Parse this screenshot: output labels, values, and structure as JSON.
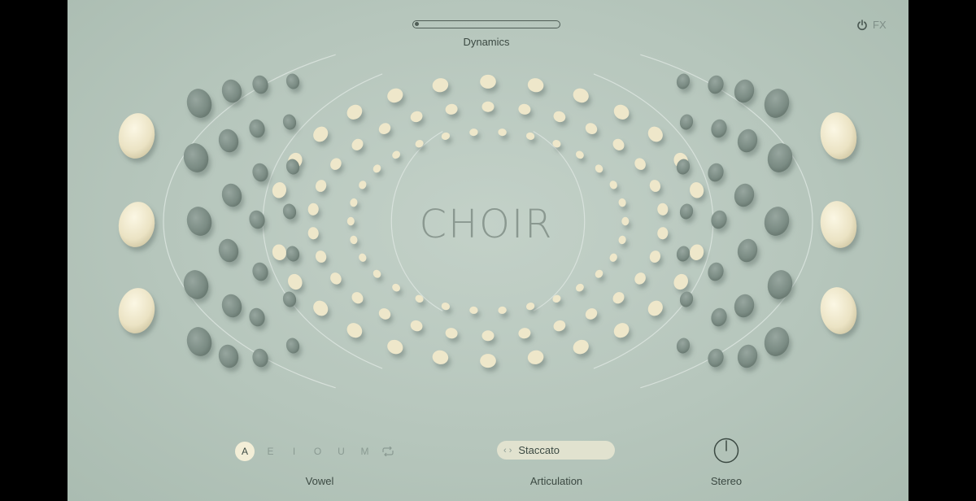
{
  "header": {
    "dynamics_label": "Dynamics",
    "dynamics_value": 0.03,
    "fx_label": "FX",
    "fx_icon": "power-icon"
  },
  "title": "CHOIR",
  "vowel": {
    "options": [
      "A",
      "E",
      "I",
      "O",
      "U",
      "M"
    ],
    "selected": "A",
    "loop_icon": "loop-icon",
    "label": "Vowel"
  },
  "articulation": {
    "value": "Staccato",
    "nav_icon": "chevron-left-right-icon",
    "label": "Articulation"
  },
  "stereo": {
    "label": "Stereo",
    "knob_value": 0.5
  },
  "colors": {
    "background": "#b9c9bf",
    "cream_pebble": "#ece6c9",
    "grey_pebble": "#7f9088",
    "text": "#3c4a43",
    "selected_bg": "#f3eed7"
  }
}
